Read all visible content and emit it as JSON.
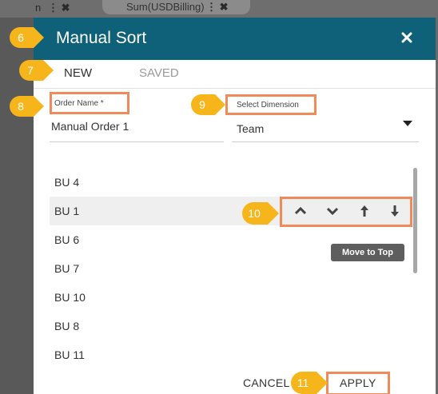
{
  "background": {
    "left_text": "n",
    "tab_text": "Sum(USDBilling)"
  },
  "dialog": {
    "title": "Manual Sort",
    "close_icon": "close-icon"
  },
  "tabs": [
    {
      "label": "NEW",
      "active": true
    },
    {
      "label": "SAVED",
      "active": false
    }
  ],
  "form": {
    "order_name_label": "Order Name *",
    "order_name_value": "Manual Order 1",
    "dimension_label": "Select Dimension",
    "dimension_value": "Team"
  },
  "list": {
    "items": [
      "BU 4",
      "BU 1",
      "BU 6",
      "BU 7",
      "BU 10",
      "BU 8",
      "BU 11"
    ],
    "selected_index": 1
  },
  "move_controls": {
    "icons": [
      "chevron-up-icon",
      "chevron-down-icon",
      "arrow-up-icon",
      "arrow-down-icon"
    ],
    "tooltip": "Move to Top"
  },
  "footer": {
    "cancel_label": "CANCEL",
    "apply_label": "APPLY"
  },
  "annotations": {
    "numbers": [
      "6",
      "7",
      "8",
      "9",
      "10",
      "11"
    ],
    "box_color": "#ef8a5b",
    "marker_color": "#f5b51b"
  },
  "colors": {
    "header": "#0f6179",
    "selected_row": "#efefef"
  }
}
